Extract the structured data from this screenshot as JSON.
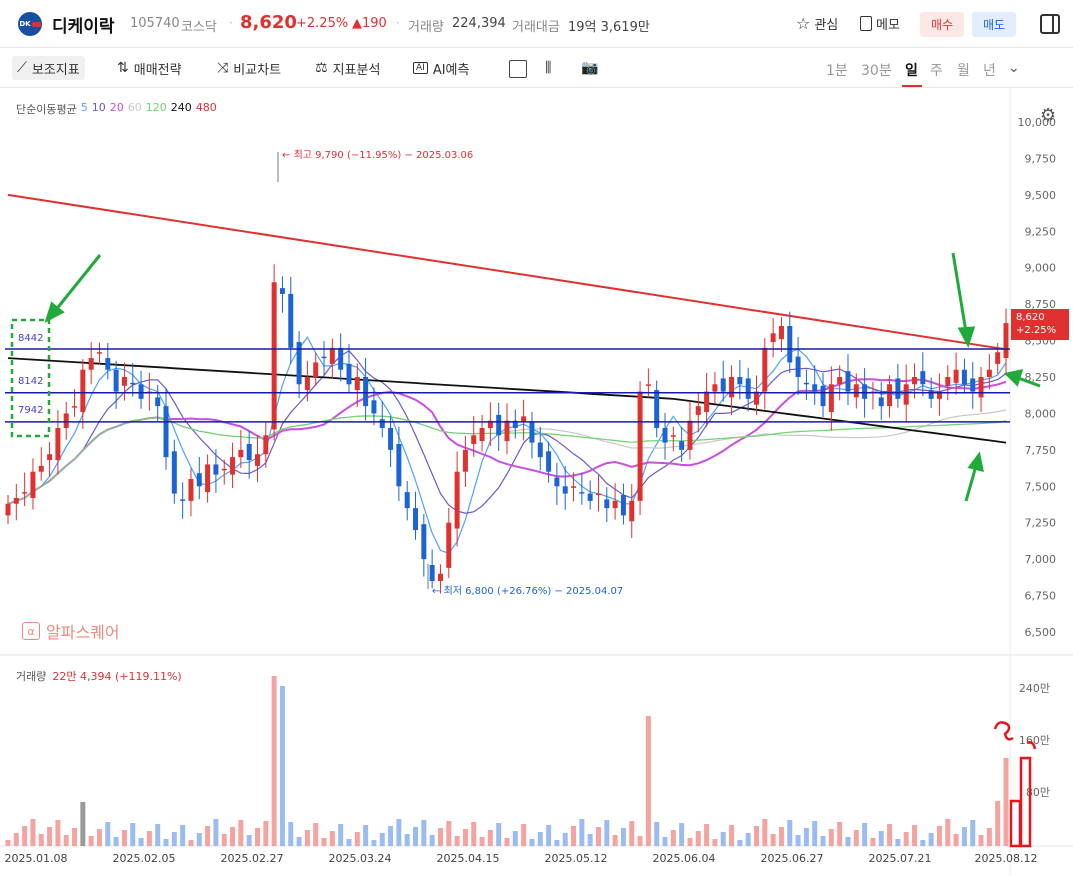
{
  "header": {
    "logo_text": "DK",
    "name": "디케이락",
    "code": "105740",
    "market": "코스닥",
    "price": "8,620",
    "change_pct": "+2.25%",
    "change_abs": "▲190",
    "volume_label": "거래량",
    "volume_value": "224,394",
    "amount_label": "거래대금",
    "amount_value": "19억 3,619만",
    "watch_label": "관심",
    "memo_label": "메모",
    "buy_label": "매수",
    "sell_label": "매도"
  },
  "toolbar": {
    "indicator_label": "보조지표",
    "strategy_label": "매매전략",
    "compare_label": "비교차트",
    "analysis_label": "지표분석",
    "ai_label": "AI예측",
    "periods": [
      "1분",
      "30분",
      "일",
      "주",
      "월",
      "년"
    ],
    "active_period": "일"
  },
  "ma_legend": {
    "title": "단순이동평균",
    "items": [
      {
        "label": "5",
        "color": "#4da3ff"
      },
      {
        "label": "10",
        "color": "#6a5acd"
      },
      {
        "label": "20",
        "color": "#c94fe0"
      },
      {
        "label": "60",
        "color": "#c8c8c8"
      },
      {
        "label": "120",
        "color": "#6fd36f"
      },
      {
        "label": "240",
        "color": "#111111"
      },
      {
        "label": "480",
        "color": "#e03131"
      }
    ]
  },
  "annotations": {
    "high": "최고 9,790 (−11.95%) − 2025.03.06",
    "low": "최저 6,800 (+26.76%) − 2025.04.07",
    "box_labels": [
      "8442",
      "8142",
      "7942"
    ]
  },
  "price_tag": {
    "price": "8,620",
    "pct": "+2.25%"
  },
  "watermark": "알파스퀘어",
  "volume_legend": {
    "label": "거래량",
    "value": "22만 4,394 (+119.11%)"
  },
  "chart_data": {
    "type": "candlestick",
    "y_axis": {
      "min": 6500,
      "max": 10000,
      "ticks": [
        "10,000",
        "9,750",
        "9,500",
        "9,250",
        "9,000",
        "8,750",
        "8,500",
        "8,250",
        "8,000",
        "7,750",
        "7,500",
        "7,250",
        "7,000",
        "6,750",
        "6,500"
      ]
    },
    "volume_axis": {
      "ticks": [
        "240만",
        "160만",
        "80만"
      ]
    },
    "x_labels": [
      "2025.01.08",
      "2025.02.05",
      "2025.02.27",
      "2025.03.24",
      "2025.04.15",
      "2025.05.12",
      "2025.06.04",
      "2025.06.27",
      "2025.07.21",
      "2025.08.12"
    ],
    "horizontal_lines": [
      8442,
      8142,
      7942
    ],
    "colors": {
      "up": "#e03131",
      "down": "#1c64d6",
      "line": "#1a1aa8"
    }
  }
}
